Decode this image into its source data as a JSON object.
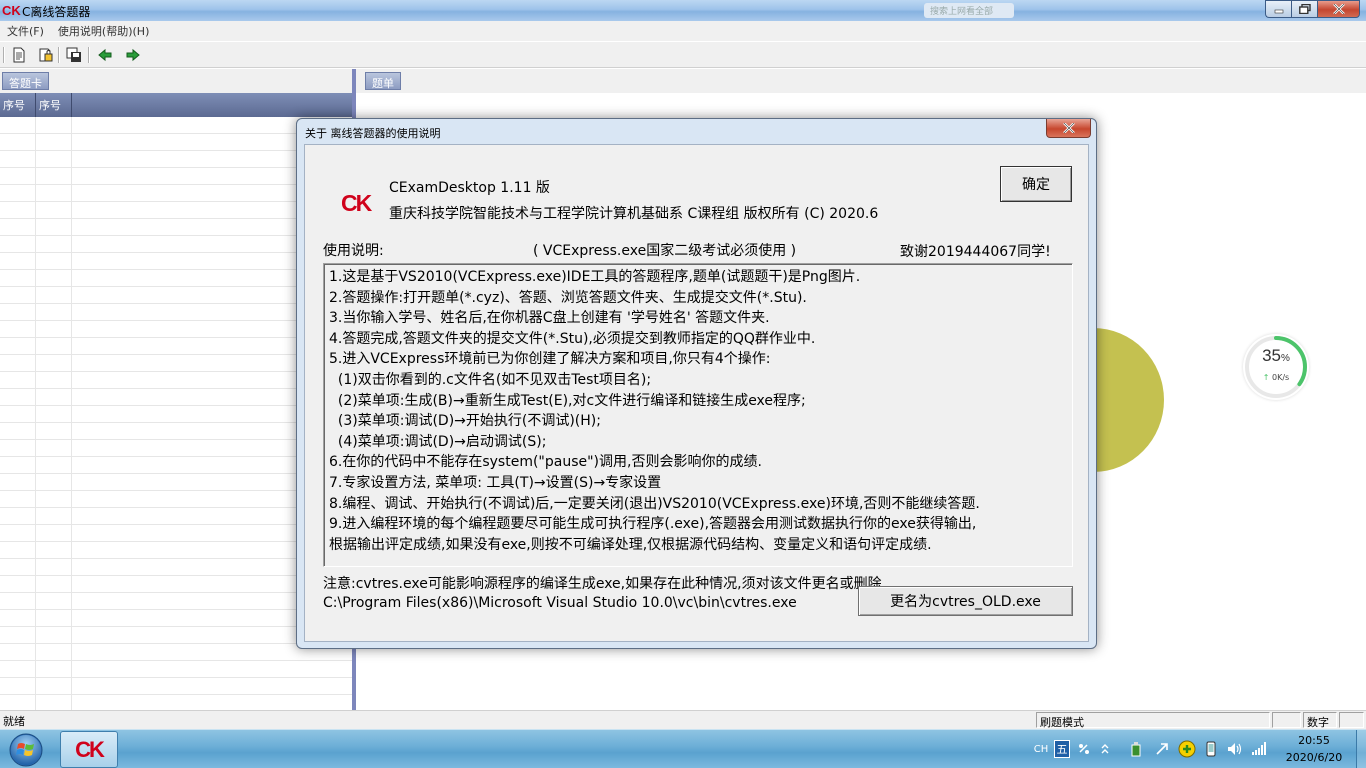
{
  "window": {
    "logo": "CK",
    "title": "C离线答题器",
    "search_placeholder": "搜索上网看全部"
  },
  "menu": [
    "文件(F)",
    "使用说明(帮助)(H)"
  ],
  "left_pane": {
    "tab": "答题卡",
    "columns": [
      "序号",
      "序号"
    ]
  },
  "right_pane": {
    "tab": "题单"
  },
  "dialog": {
    "title": "关于 离线答题器的使用说明",
    "logo": "CK",
    "app_name": "CExamDesktop 1.11 版",
    "copyright": "重庆科技学院智能技术与工程学院计算机基础系 C课程组  版权所有 (C) 2020.6",
    "ok_label": "确定",
    "usage_label": "使用说明:",
    "usage_note": "( VCExpress.exe国家二级考试必须使用 )",
    "thanks": "致谢2019444067同学!",
    "notes": [
      "1.这是基于VS2010(VCExpress.exe)IDE工具的答题程序,题单(试题题干)是Png图片.",
      "2.答题操作:打开题单(*.cyz)、答题、浏览答题文件夹、生成提交文件(*.Stu).",
      "3.当你输入学号、姓名后,在你机器C盘上创建有 '学号姓名' 答题文件夹.",
      "4.答题完成,答题文件夹的提交文件(*.Stu),必须提交到教师指定的QQ群作业中.",
      "5.进入VCExpress环境前已为你创建了解决方案和项目,你只有4个操作:",
      "  (1)双击你看到的.c文件名(如不见双击Test项目名);",
      "  (2)菜单项:生成(B)→重新生成Test(E),对c文件进行编译和链接生成exe程序;",
      "  (3)菜单项:调试(D)→开始执行(不调试)(H);",
      "  (4)菜单项:调试(D)→启动调试(S);",
      "6.在你的代码中不能存在system(\"pause\")调用,否则会影响你的成绩.",
      "7.专家设置方法, 菜单项: 工具(T)→设置(S)→专家设置",
      "8.编程、调试、开始执行(不调试)后,一定要关闭(退出)VS2010(VCExpress.exe)环境,否则不能继续答题.",
      "9.进入编程环境的每个编程题要尽可能生成可执行程序(.exe),答题器会用测试数据执行你的exe获得输出,",
      "根据输出评定成绩,如果没有exe,则按不可编译处理,仅根据源代码结构、变量定义和语句评定成绩."
    ],
    "warning": "注意:cvtres.exe可能影响源程序的编译生成exe,如果存在此种情况,须对该文件更名或删除.",
    "cvtres_path": "C:\\Program Files(x86)\\Microsoft Visual Studio 10.0\\vc\\bin\\cvtres.exe",
    "rename_label": "更名为cvtres_OLD.exe"
  },
  "speed_widget": {
    "percent": "35",
    "percent_sign": "%",
    "rate": "0K/s",
    "progress": 0.35,
    "accent": "#4cc46a"
  },
  "status": {
    "ready": "就绪",
    "mode": "刷题模式",
    "numlock": "数字"
  },
  "taskbar": {
    "app_logo": "CK",
    "tray": {
      "lang": "CH",
      "ime": "五"
    },
    "time": "20:55",
    "date": "2020/6/20"
  },
  "colors": {
    "brand_red": "#d0021b",
    "dialog_frame": "#d9e6f4",
    "pane_header": "#7e8eb6"
  }
}
